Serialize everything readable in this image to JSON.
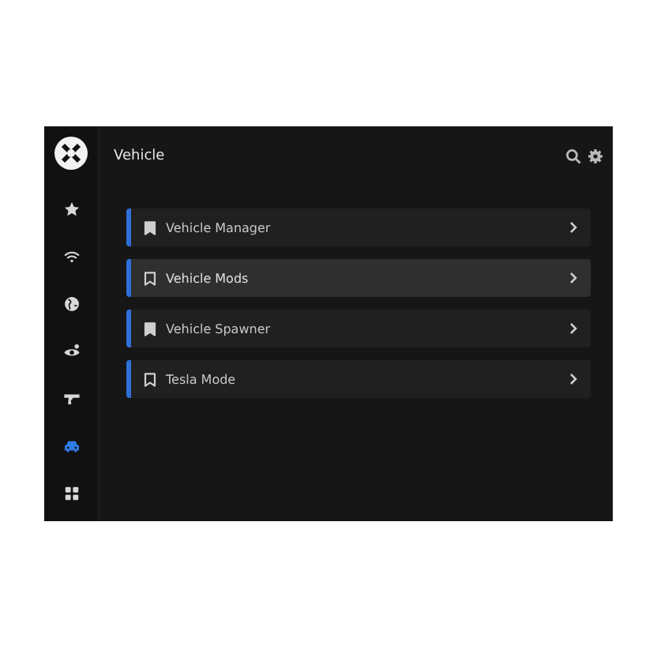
{
  "sidebar": {
    "items": [
      {
        "selected": false
      },
      {
        "selected": false
      },
      {
        "selected": false
      },
      {
        "selected": false
      },
      {
        "selected": false
      },
      {
        "selected": true
      },
      {
        "selected": false
      }
    ]
  },
  "header": {
    "title": "Vehicle"
  },
  "items": [
    {
      "label": "Vehicle Manager",
      "bookmarked": true,
      "highlighted": false
    },
    {
      "label": "Vehicle Mods",
      "bookmarked": false,
      "highlighted": true
    },
    {
      "label": "Vehicle Spawner",
      "bookmarked": true,
      "highlighted": false
    },
    {
      "label": "Tesla Mode",
      "bookmarked": false,
      "highlighted": false
    }
  ]
}
